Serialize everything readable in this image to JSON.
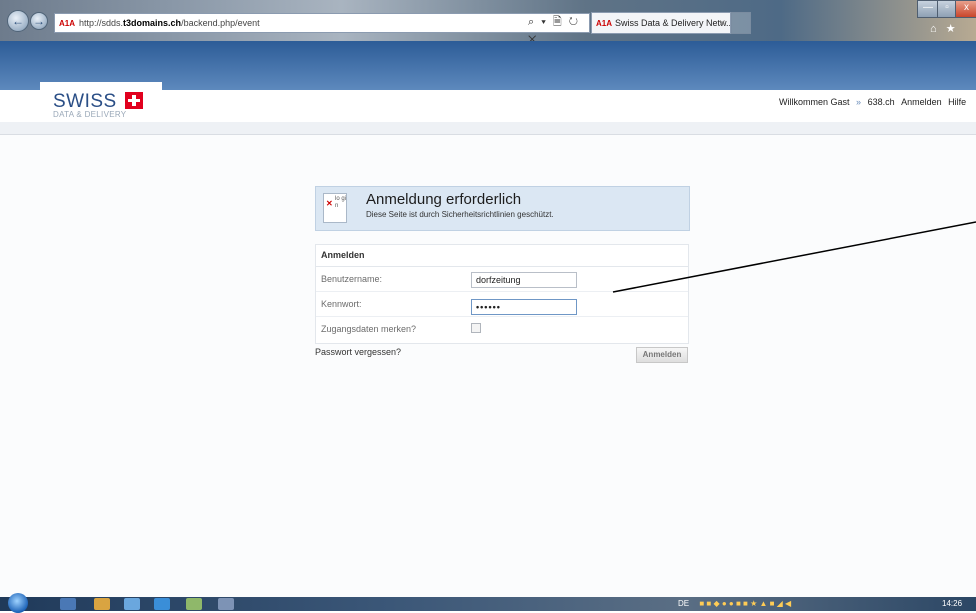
{
  "browser": {
    "url_prefix": "http://sdds.",
    "url_domain": "t3domains.ch",
    "url_path": "/backend.php/event",
    "favicon_text": "A1A",
    "address_tools": "⌕ ▾ 🗎 ↻ ✕",
    "tab_title": "Swiss Data & Delivery Netw...",
    "tab_close": "✕",
    "window_min": "—",
    "window_max": "▫",
    "window_close": "x",
    "right_tools": "⌂ ★"
  },
  "site": {
    "logo_word": "SWISS",
    "logo_tagline": "DATA & DELIVERY",
    "nav": {
      "welcome": "Willkommen Gast",
      "separator": "»",
      "site": "638.ch",
      "login": "Anmelden",
      "help": "Hilfe"
    }
  },
  "notice": {
    "icon_text": "lo gi n",
    "title": "Anmeldung erforderlich",
    "subtitle": "Diese Seite ist durch Sicherheitsrichtlinien geschützt."
  },
  "form": {
    "heading": "Anmelden",
    "username_label": "Benutzername:",
    "username_value": "dorfzeitung",
    "password_label": "Kennwort:",
    "password_value": "••••••",
    "remember_label": "Zugangsdaten merken?",
    "forgot_label": "Passwort vergessen?",
    "submit_label": "Anmelden"
  },
  "taskbar": {
    "language": "DE",
    "clock": "14:26"
  },
  "colors": {
    "header_band": "#2c5c97",
    "swiss_red": "#e1001e",
    "notice_bg": "#dbe7f3"
  }
}
